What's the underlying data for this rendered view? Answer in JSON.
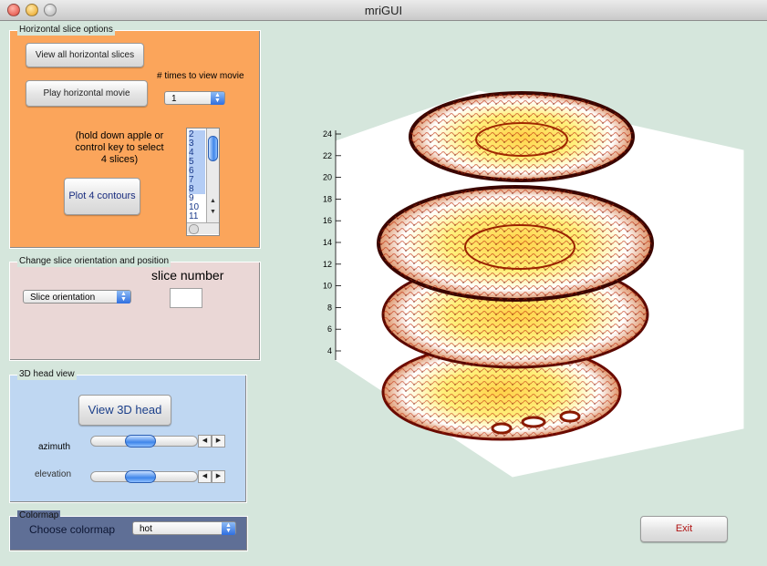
{
  "window": {
    "title": "mriGUI"
  },
  "horizontal_panel": {
    "title": "Horizontal slice options",
    "view_all_button": "View all horizontal slices",
    "play_movie_button": "Play horizontal movie",
    "times_label": "# times to view movie",
    "times_value": "1",
    "hold_text": "(hold down apple or control key to select 4 slices)",
    "plot_contours_button": "Plot 4 contours",
    "slice_list": [
      "2",
      "3",
      "4",
      "5",
      "6",
      "7",
      "8",
      "9",
      "10",
      "11"
    ],
    "slice_list_selected": [
      "2",
      "3",
      "4",
      "5",
      "6",
      "7",
      "8"
    ]
  },
  "orientation_panel": {
    "title": "Change slice orientation and position",
    "slice_number_label": "slice number",
    "slice_number_value": "",
    "orientation_value": "Slice orientation"
  },
  "head_panel": {
    "title": "3D head view",
    "view_button": "View 3D head",
    "azimuth_label": "azimuth",
    "azimuth_fraction": 0.45,
    "elevation_label": "elevation",
    "elevation_fraction": 0.45
  },
  "colormap_panel": {
    "title": "Colormap",
    "choose_label": "Choose colormap",
    "value": "hot"
  },
  "exit_button": "Exit",
  "axes": {
    "z_ticks": [
      "24",
      "22",
      "20",
      "18",
      "16",
      "14",
      "12",
      "10",
      "8",
      "6",
      "4"
    ]
  },
  "colors": {
    "window_bg": "#d5e6dc",
    "horizontal_panel": "#fba55b",
    "orientation_panel": "#ead7d6",
    "head_panel": "#bfd7f2",
    "colormap_panel": "#5f6f96"
  }
}
